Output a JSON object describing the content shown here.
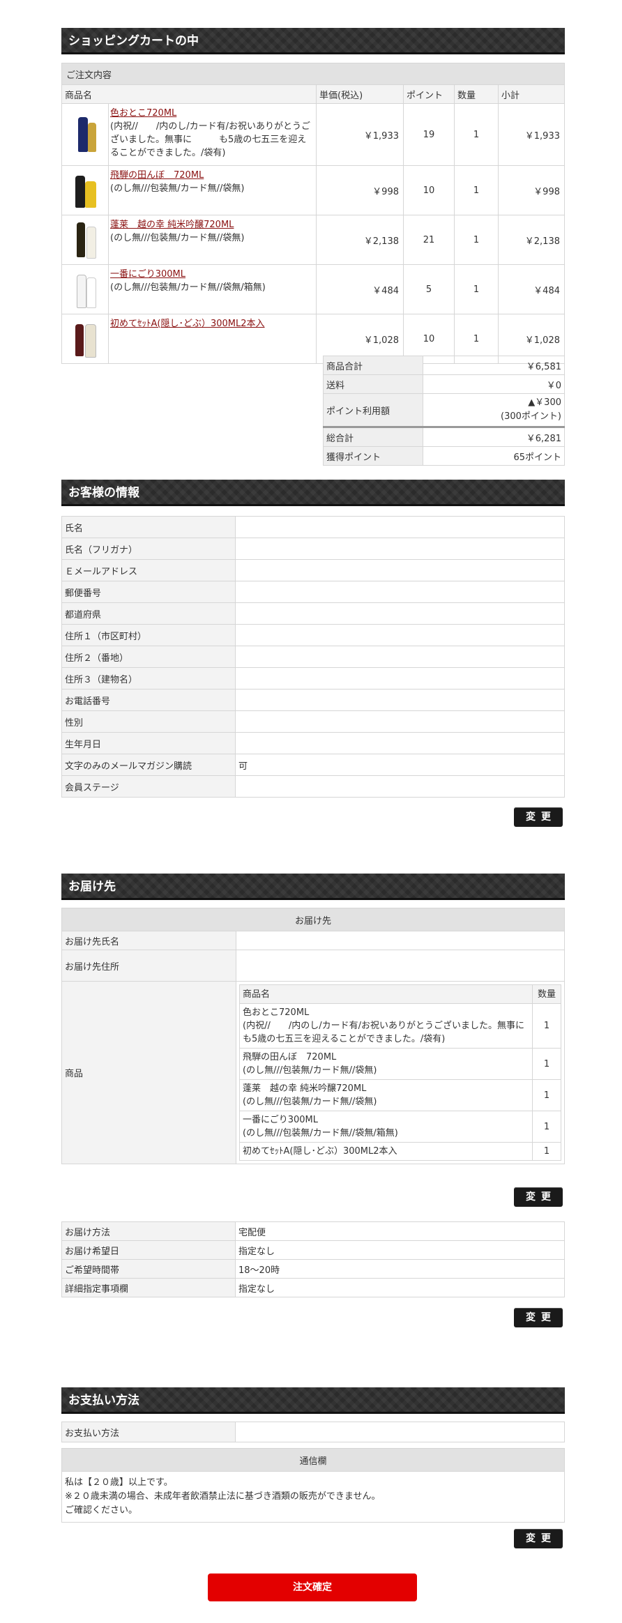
{
  "cart": {
    "heading": "ショッピングカートの中",
    "caption": "ご注文内容",
    "headers": {
      "name": "商品名",
      "price": "単価(税込)",
      "points": "ポイント",
      "qty": "数量",
      "subtotal": "小計"
    },
    "items": [
      {
        "name": "色おとこ720ML",
        "note": "(内祝//　　/内のし/カード有/お祝いありがとうございました。無事に　　　も5歳の七五三を迎えることができました。/袋有)",
        "price": "￥1,933",
        "points": "19",
        "qty": "1",
        "subtotal": "￥1,933"
      },
      {
        "name": "飛騨の田んぼ　720ML",
        "note": "(のし無///包装無/カード無//袋無)",
        "price": "￥998",
        "points": "10",
        "qty": "1",
        "subtotal": "￥998"
      },
      {
        "name": "蓬莱　越の幸 純米吟醸720ML",
        "note": "(のし無///包装無/カード無//袋無)",
        "price": "￥2,138",
        "points": "21",
        "qty": "1",
        "subtotal": "￥2,138"
      },
      {
        "name": "一番にごり300ML",
        "note": "(のし無///包装無/カード無//袋無/箱無)",
        "price": "￥484",
        "points": "5",
        "qty": "1",
        "subtotal": "￥484"
      },
      {
        "name": "初めてｾｯﾄA(隠し･どぶ）300ML2本入",
        "note": "",
        "price": "￥1,028",
        "points": "10",
        "qty": "1",
        "subtotal": "￥1,028"
      }
    ],
    "summary": {
      "goods_total_label": "商品合計",
      "goods_total": "￥6,581",
      "shipping_label": "送料",
      "shipping": "￥0",
      "points_used_label": "ポイント利用額",
      "points_used": "▲￥300",
      "points_used_note": "(300ポイント)",
      "grand_total_label": "総合計",
      "grand_total": "￥6,281",
      "earned_label": "獲得ポイント",
      "earned": "65ポイント"
    }
  },
  "customer": {
    "heading": "お客様の情報",
    "rows": [
      {
        "label": "氏名",
        "value": ""
      },
      {
        "label": "氏名（フリガナ）",
        "value": ""
      },
      {
        "label": "Ｅメールアドレス",
        "value": ""
      },
      {
        "label": "郵便番号",
        "value": ""
      },
      {
        "label": "都道府県",
        "value": ""
      },
      {
        "label": "住所１（市区町村）",
        "value": ""
      },
      {
        "label": "住所２（番地）",
        "value": ""
      },
      {
        "label": "住所３（建物名）",
        "value": ""
      },
      {
        "label": "お電話番号",
        "value": ""
      },
      {
        "label": "性別",
        "value": ""
      },
      {
        "label": "生年月日",
        "value": ""
      },
      {
        "label": "文字のみのメールマガジン購読",
        "value": "可"
      },
      {
        "label": "会員ステージ",
        "value": ""
      }
    ],
    "change_label": "変更"
  },
  "shipping": {
    "heading": "お届け先",
    "caption": "お届け先",
    "name_label": "お届け先氏名",
    "address_label": "お届け先住所",
    "goods_label": "商品",
    "sub_headers": {
      "name": "商品名",
      "qty": "数量"
    },
    "items": [
      {
        "line1": "色おとこ720ML",
        "line2": "(内祝//　　/内のし/カード有/お祝いありがとうございました。無事に　　　も5歳の七五三を迎えることができました。/袋有)",
        "qty": "1"
      },
      {
        "line1": "飛騨の田んぼ　720ML",
        "line2": "(のし無///包装無/カード無//袋無)",
        "qty": "1"
      },
      {
        "line1": "蓬莱　越の幸 純米吟醸720ML",
        "line2": "(のし無///包装無/カード無//袋無)",
        "qty": "1"
      },
      {
        "line1": "一番にごり300ML",
        "line2": "(のし無///包装無/カード無//袋無/箱無)",
        "qty": "1"
      },
      {
        "line1": "初めてｾｯﾄA(隠し･どぶ）300ML2本入",
        "line2": "",
        "qty": "1"
      }
    ],
    "change_label": "変更",
    "delivery": [
      {
        "label": "お届け方法",
        "value": "宅配便"
      },
      {
        "label": "お届け希望日",
        "value": "指定なし"
      },
      {
        "label": "ご希望時間帯",
        "value": "18～20時"
      },
      {
        "label": "詳細指定事項欄",
        "value": "指定なし"
      }
    ],
    "delivery_change_label": "変更"
  },
  "payment": {
    "heading": "お支払い方法",
    "method_label": "お支払い方法",
    "method_value": "",
    "comm_caption": "通信欄",
    "comm_lines": [
      "私は【２０歳】以上です。",
      "※２０歳未満の場合、未成年者飲酒禁止法に基づき酒類の販売ができません。",
      "ご確認ください。"
    ],
    "change_label": "変更"
  },
  "confirm_label": "注文確定"
}
